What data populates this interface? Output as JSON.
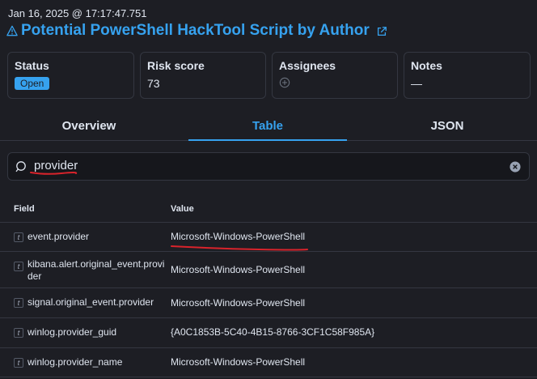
{
  "header": {
    "timestamp": "Jan 16, 2025 @ 17:17:47.751",
    "title": "Potential PowerShell HackTool Script by Author"
  },
  "cards": {
    "status": {
      "label": "Status",
      "value": "Open"
    },
    "risk": {
      "label": "Risk score",
      "value": "73"
    },
    "assignees": {
      "label": "Assignees"
    },
    "notes": {
      "label": "Notes",
      "value": "—"
    }
  },
  "tabs": [
    "Overview",
    "Table",
    "JSON"
  ],
  "active_tab": "Table",
  "search": {
    "value": "provider"
  },
  "table": {
    "headers": {
      "field": "Field",
      "value": "Value"
    },
    "type_badge": "t",
    "rows": [
      {
        "field": "event.provider",
        "value": "Microsoft-Windows-PowerShell"
      },
      {
        "field": "kibana.alert.original_event.provider",
        "value": "Microsoft-Windows-PowerShell"
      },
      {
        "field": "signal.original_event.provider",
        "value": "Microsoft-Windows-PowerShell"
      },
      {
        "field": "winlog.provider_guid",
        "value": "{A0C1853B-5C40-4B15-8766-3CF1C58F985A}"
      },
      {
        "field": "winlog.provider_name",
        "value": "Microsoft-Windows-PowerShell"
      }
    ]
  },
  "colors": {
    "accent": "#36a2ef",
    "annotation": "#d9232b",
    "background": "#1d1e24"
  },
  "icons": [
    "warning-icon",
    "external-link-icon",
    "add-assignee-icon",
    "search-icon",
    "clear-icon"
  ]
}
